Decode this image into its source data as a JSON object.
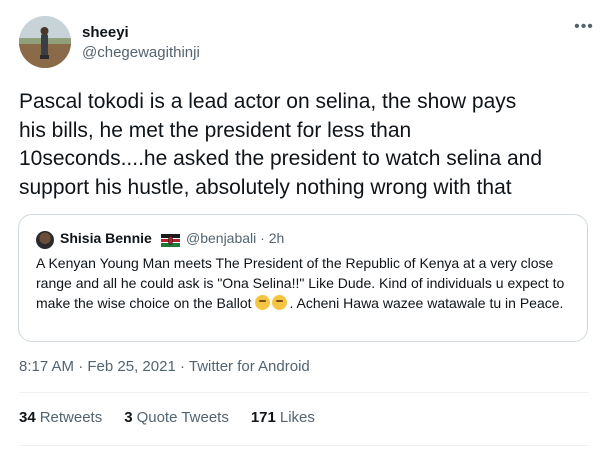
{
  "author": {
    "name": "sheeyi",
    "handle": "@chegewagithinji"
  },
  "tweet": {
    "text": "Pascal tokodi is a lead actor on selina, the show pays\nhis bills, he met the president for less than\n10seconds....he asked the president to watch selina and\nsupport his hustle, absolutely nothing wrong with that"
  },
  "quoted": {
    "name": "Shisia Bennie",
    "handle": "@benjabali",
    "time": "· 2h",
    "text": "A Kenyan Young Man meets The President of the Republic of Kenya at a very close range and all he could ask is \"Ona Selina!!\" Like Dude. Kind of individuals u expect to make the wise choice on the Ballot ",
    "text_end": ". Acheni Hawa wazee watawale tu in Peace.",
    "emoji": "thinking-face-icon"
  },
  "meta": {
    "time": "8:17 AM",
    "sep1": " · ",
    "date": "Feb 25, 2021",
    "sep2": " · ",
    "source": "Twitter for Android"
  },
  "stats": {
    "retweets_count": "34",
    "retweets_label": "Retweets",
    "quotes_count": "3",
    "quotes_label": "Quote Tweets",
    "likes_count": "171",
    "likes_label": "Likes"
  },
  "colors": {
    "text": "#0f1419",
    "secondary": "#536471",
    "border": "#cfd9de",
    "divider": "#eff3f4"
  }
}
